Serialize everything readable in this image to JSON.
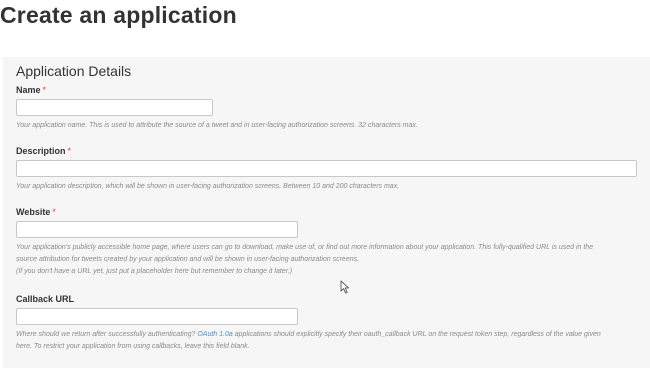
{
  "page_title": "Create an application",
  "section_title": "Application Details",
  "required_marker": "*",
  "fields": {
    "name": {
      "label": "Name",
      "value": "",
      "help": "Your application name. This is used to attribute the source of a tweet and in user-facing authorization screens. 32 characters max."
    },
    "description": {
      "label": "Description",
      "value": "",
      "help": "Your application description, which will be shown in user-facing authorization screens. Between 10 and 200 characters max."
    },
    "website": {
      "label": "Website",
      "value": "",
      "help_line1": "Your application's publicly accessible home page, where users can go to download, make use of, or find out more information about your application. This fully-qualified URL is used in the",
      "help_line2": "source attribution for tweets created by your application and will be shown in user-facing authorization screens.",
      "help_line3": "(If you don't have a URL yet, just put a placeholder here but remember to change it later.)"
    },
    "callback_url": {
      "label": "Callback URL",
      "value": "",
      "help_prefix": "Where should we return after successfully authenticating?",
      "help_link": "OAuth 1.0a",
      "help_suffix": "applications should explicitly specify their oauth_callback URL on the request token step, regardless of the value given",
      "help_line2": "here. To restrict your application from using callbacks, leave this field blank."
    }
  },
  "colors": {
    "panel_background": "#f6f6f6",
    "required_marker": "#e0443c",
    "link": "#4a90c8",
    "help_text": "#8a8a8a"
  },
  "icons": {
    "cursor": "mouse-pointer-icon"
  }
}
